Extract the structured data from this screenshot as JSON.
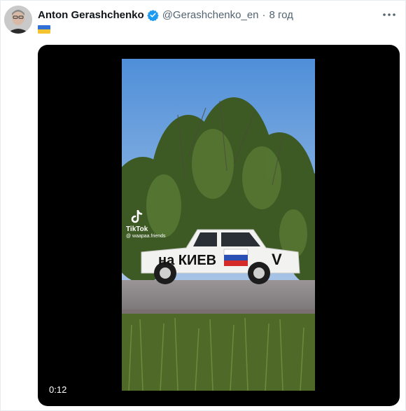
{
  "tweet": {
    "author_name": "Anton Gerashchenko",
    "author_handle": "@Gerashchenko_en",
    "separator": "·",
    "time": "8 год",
    "verified": true,
    "flag_emoji_name": "ukraine-flag"
  },
  "video": {
    "duration_label": "0:12",
    "watermark_brand": "TikTok",
    "watermark_user": "@ waapaa.friends",
    "car_text": "на КИЕВ",
    "car_letter": "V"
  },
  "colors": {
    "verified_blue": "#1d9bf0",
    "muted_text": "#536471",
    "sky": "#5b93d6",
    "road": "#8d8a8c"
  },
  "icons": {
    "more": "more-horizontal-icon",
    "verified": "verified-badge-icon"
  }
}
